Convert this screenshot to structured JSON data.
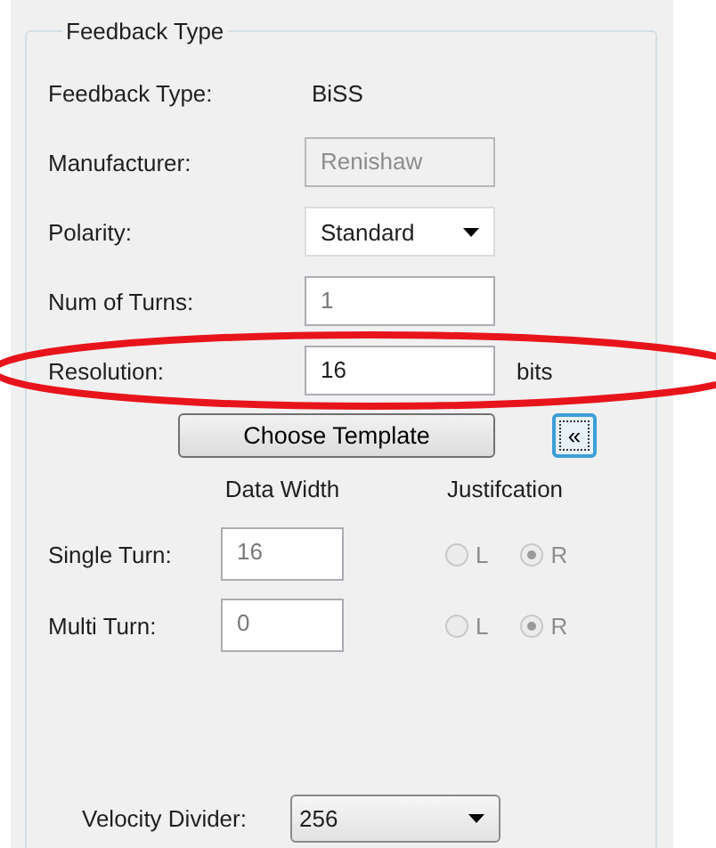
{
  "group": {
    "title": "Feedback Type"
  },
  "fields": [
    {
      "kind": "text",
      "label": "Feedback Type:",
      "value": "BiSS"
    },
    {
      "kind": "input",
      "label": "Manufacturer:",
      "value": "Renishaw",
      "disabled": true,
      "read_only": true
    },
    {
      "kind": "select",
      "label": "Polarity:",
      "value": "Standard"
    },
    {
      "kind": "input",
      "label": "Num of Turns:",
      "value": "1",
      "disabled": false,
      "read_only": true
    },
    {
      "kind": "input",
      "label": "Resolution:",
      "value": "16",
      "unit": "bits",
      "disabled": false,
      "read_only": false,
      "circled": true
    }
  ],
  "template_button": "Choose Template",
  "collapse_button": "«",
  "columns": [
    "Data Width",
    "Justifcation"
  ],
  "width_rows": [
    {
      "label": "Single Turn:",
      "value": "16",
      "read_only": true,
      "options": [
        {
          "label": "L",
          "selected": false,
          "disabled": true
        },
        {
          "label": "R",
          "selected": true,
          "disabled": true
        }
      ]
    },
    {
      "label": "Multi Turn:",
      "value": "0",
      "read_only": true,
      "options": [
        {
          "label": "L",
          "selected": false,
          "disabled": true
        },
        {
          "label": "R",
          "selected": true,
          "disabled": true
        }
      ]
    }
  ],
  "velocity_divider": {
    "label": "Velocity Divider:",
    "value": "256"
  }
}
